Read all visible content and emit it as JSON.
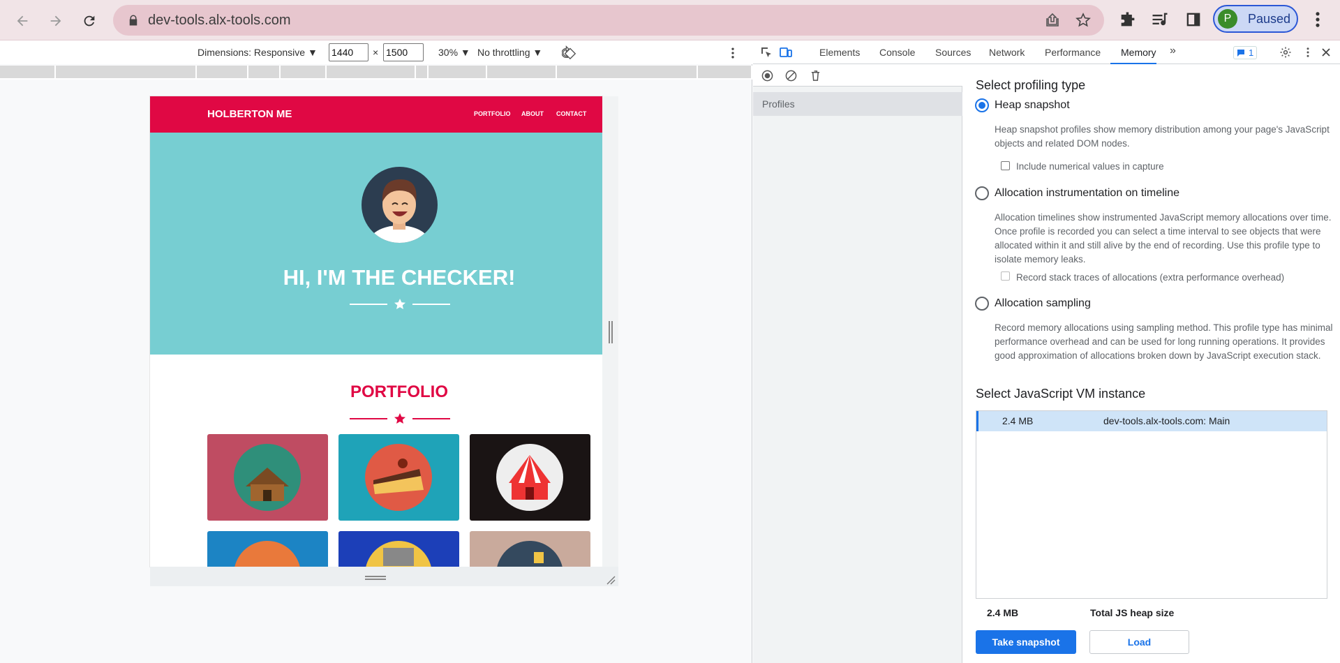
{
  "browser": {
    "url": "dev-tools.alx-tools.com",
    "profile_initial": "P",
    "profile_status": "Paused"
  },
  "device_toolbar": {
    "dimensions_label": "Dimensions: Responsive",
    "width": "1440",
    "height": "1500",
    "times": "×",
    "zoom": "30%",
    "throttling": "No throttling"
  },
  "site": {
    "brand": "HOLBERTON ME",
    "nav": [
      "PORTFOLIO",
      "ABOUT",
      "CONTACT"
    ],
    "hero_title": "HI, I'M THE CHECKER!",
    "portfolio_title": "PORTFOLIO"
  },
  "devtools": {
    "tabs": [
      "Elements",
      "Console",
      "Sources",
      "Network",
      "Performance",
      "Memory"
    ],
    "active_tab": "Memory",
    "issues_count": "1",
    "profiles_label": "Profiles"
  },
  "memory": {
    "select_profiling_type": "Select profiling type",
    "options": [
      {
        "label": "Heap snapshot",
        "selected": true,
        "description": "Heap snapshot profiles show memory distribution among your page's JavaScript objects and related DOM nodes.",
        "checkbox": "Include numerical values in capture"
      },
      {
        "label": "Allocation instrumentation on timeline",
        "selected": false,
        "description": "Allocation timelines show instrumented JavaScript memory allocations over time. Once profile is recorded you can select a time interval to see objects that were allocated within it and still alive by the end of recording. Use this profile type to isolate memory leaks.",
        "checkbox": "Record stack traces of allocations (extra performance overhead)"
      },
      {
        "label": "Allocation sampling",
        "selected": false,
        "description": "Record memory allocations using sampling method. This profile type has minimal performance overhead and can be used for long running operations. It provides good approximation of allocations broken down by JavaScript execution stack."
      }
    ],
    "vm_title": "Select JavaScript VM instance",
    "vm_instances": [
      {
        "size": "2.4 MB",
        "name": "dev-tools.alx-tools.com: Main"
      }
    ],
    "total_heap_size": "2.4 MB",
    "total_heap_label": "Total JS heap size",
    "take_snapshot_label": "Take snapshot",
    "load_label": "Load"
  },
  "colors": {
    "site_accent": "#e00844",
    "hero_bg": "#77ced2",
    "devtools_blue": "#1a73e8"
  }
}
